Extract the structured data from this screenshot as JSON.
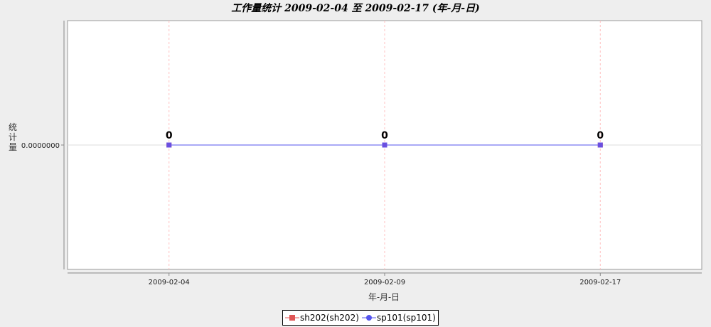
{
  "title": "工作量统计 2009-02-04 至 2009-02-17 (年-月-日)",
  "colors": {
    "plot_bg": "#ffffff",
    "page_bg": "#eeeeee",
    "grid": "#ffc0c0",
    "series_sh202": "#e05555",
    "series_sp101": "#5555ee"
  },
  "chart_data": {
    "type": "line",
    "title": "工作量统计 2009-02-04 至 2009-02-17 (年-月-日)",
    "xlabel": "年-月-日",
    "ylabel": "统计量",
    "categories": [
      "2009-02-04",
      "2009-02-09",
      "2009-02-17"
    ],
    "y_ticks": [
      "0.0000000"
    ],
    "ylim": [
      -1,
      1
    ],
    "grid": true,
    "legend_position": "bottom",
    "series": [
      {
        "name": "sh202(sh202)",
        "values": [
          0,
          0,
          0
        ],
        "marker": "square",
        "color": "#e05555"
      },
      {
        "name": "sp101(sp101)",
        "values": [
          0,
          0,
          0
        ],
        "marker": "square",
        "color": "#5555ee"
      }
    ],
    "data_labels": [
      "0",
      "0",
      "0"
    ]
  }
}
